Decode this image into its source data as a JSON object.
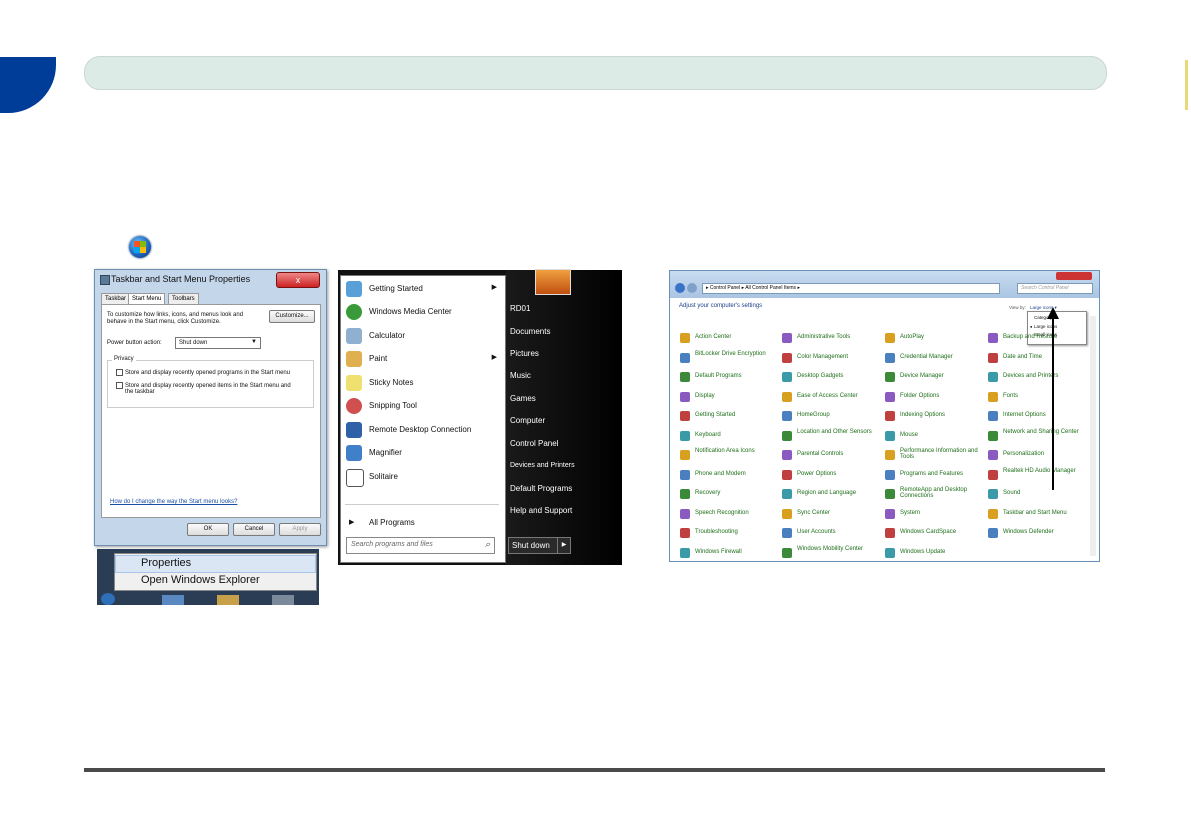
{
  "taskbar_dialog": {
    "title": "Taskbar and Start Menu Properties",
    "close_label": "x",
    "tabs": [
      "Taskbar",
      "Start Menu",
      "Toolbars"
    ],
    "intro_text_1": "To customize how links, icons, and menus look and",
    "intro_text_2": "behave in the Start menu, click Customize.",
    "customize_label": "Customize...",
    "power_button_label": "Power button action:",
    "power_button_value": "Shut down",
    "privacy_group_label": "Privacy",
    "privacy_option_1": "Store and display recently opened programs in the Start menu",
    "privacy_option_2_line1": "Store and display recently opened items in the Start menu and",
    "privacy_option_2_line2": "the taskbar",
    "help_link": "How do I change the way the Start menu looks?",
    "ok_label": "OK",
    "cancel_label": "Cancel",
    "apply_label": "Apply"
  },
  "context_menu": {
    "items": [
      "Properties",
      "Open Windows Explorer"
    ]
  },
  "start_menu": {
    "programs": [
      "Getting Started",
      "Windows Media Center",
      "Calculator",
      "Paint",
      "Sticky Notes",
      "Snipping Tool",
      "Remote Desktop Connection",
      "Magnifier",
      "Solitaire"
    ],
    "all_programs": "All Programs",
    "search_placeholder": "Search programs and files",
    "right_links": [
      "RD01",
      "Documents",
      "Pictures",
      "Music",
      "Games",
      "Computer",
      "Control Panel",
      "Devices and Printers",
      "Default Programs",
      "Help and Support"
    ],
    "shutdown_label": "Shut down"
  },
  "control_panel": {
    "address": "▸ Control Panel ▸ All Control Panel Items ▸",
    "search_placeholder": "Search Control Panel",
    "heading": "Adjust your computer's settings",
    "view_by_label": "View by:",
    "view_by_value": "Large icons ▾",
    "view_by_options": [
      "Category",
      "Large icons",
      "Small icons"
    ],
    "columns": [
      [
        "Action Center",
        "BitLocker Drive Encryption",
        "Default Programs",
        "Display",
        "Getting Started",
        "Keyboard",
        "Notification Area Icons",
        "Phone and Modem",
        "Recovery",
        "Speech Recognition",
        "Troubleshooting",
        "Windows Firewall"
      ],
      [
        "Administrative Tools",
        "Color Management",
        "Desktop Gadgets",
        "Ease of Access Center",
        "HomeGroup",
        "Location and Other Sensors",
        "Parental Controls",
        "Power Options",
        "Region and Language",
        "Sync Center",
        "User Accounts",
        "Windows Mobility Center"
      ],
      [
        "AutoPlay",
        "Credential Manager",
        "Device Manager",
        "Folder Options",
        "Indexing Options",
        "Mouse",
        "Performance Information and Tools",
        "Programs and Features",
        "RemoteApp and Desktop Connections",
        "System",
        "Windows CardSpace",
        "Windows Update"
      ],
      [
        "Backup and Restore",
        "Date and Time",
        "Devices and Printers",
        "Fonts",
        "Internet Options",
        "Network and Sharing Center",
        "Personalization",
        "Realtek HD Audio Manager",
        "Sound",
        "Taskbar and Start Menu",
        "Windows Defender",
        ""
      ]
    ]
  },
  "colors": {
    "page_tab": "#003d99",
    "header_bar": "#dcebe5",
    "cp_link": "#1f6f1a"
  }
}
